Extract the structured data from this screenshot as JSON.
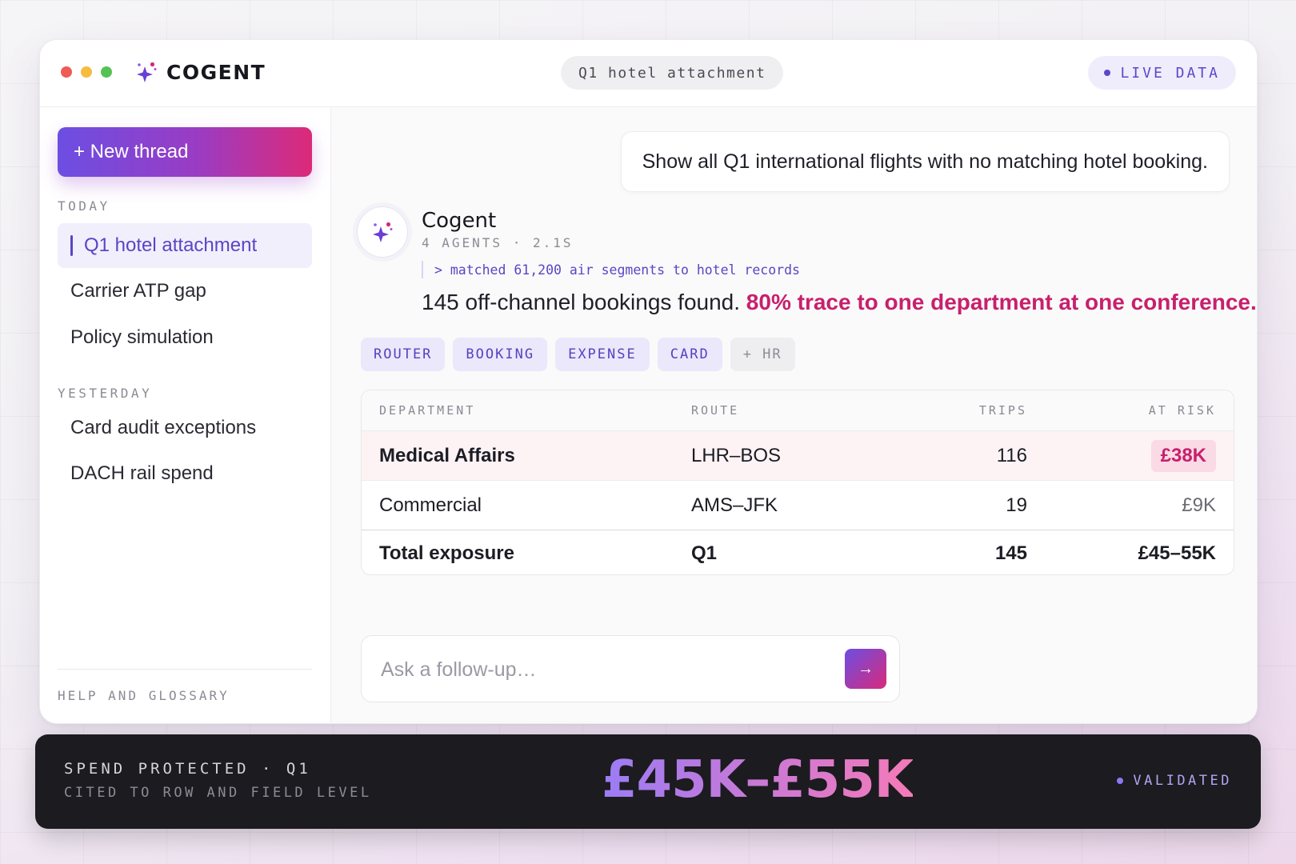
{
  "app": {
    "brand": "COGENT",
    "thread_title": "Q1 hotel attachment",
    "live_badge": "LIVE DATA",
    "window_dots": [
      "#ef5b57",
      "#f5bc3f",
      "#57c254"
    ]
  },
  "sidebar": {
    "new_thread_label": "+ New thread",
    "today_label": "TODAY",
    "today_items": [
      "Q1 hotel attachment",
      "Carrier ATP gap",
      "Policy simulation"
    ],
    "yesterday_label": "YESTERDAY",
    "yesterday_items": [
      "Card audit exceptions",
      "DACH rail spend"
    ],
    "help_label": "HELP AND GLOSSARY"
  },
  "chat": {
    "user_message": "Show all Q1 international flights with no matching hotel booking.",
    "bot_name": "Cogent",
    "bot_meta": "4 AGENTS · 2.1S",
    "trace": "> matched 61,200 air segments to hotel records",
    "answer_plain": "145 off-channel bookings found. ",
    "answer_highlight": "80% trace to one department at one conference.",
    "tags": [
      "ROUTER",
      "BOOKING",
      "EXPENSE",
      "CARD"
    ],
    "tag_extra": "+ HR"
  },
  "table": {
    "headers": [
      "DEPARTMENT",
      "ROUTE",
      "TRIPS",
      "AT RISK"
    ],
    "rows": [
      {
        "department": "Medical Affairs",
        "route": "LHR–BOS",
        "trips": "116",
        "at_risk": "£38K"
      },
      {
        "department": "Commercial",
        "route": "AMS–JFK",
        "trips": "19",
        "at_risk": "£9K"
      }
    ],
    "total": {
      "department": "Total exposure",
      "route": "Q1",
      "trips": "145",
      "at_risk": "£45–55K"
    }
  },
  "composer": {
    "placeholder": "Ask a follow-up…",
    "send_glyph": "→"
  },
  "footer": {
    "line1": "SPEND PROTECTED · Q1",
    "line2": "CITED TO ROW AND FIELD LEVEL",
    "amount": "£45K–£55K",
    "status": "VALIDATED"
  },
  "colors": {
    "accent": "#5a45c4",
    "highlight": "#c8206c",
    "gradient_start": "#6c4ee2",
    "gradient_end": "#dc2a78"
  }
}
